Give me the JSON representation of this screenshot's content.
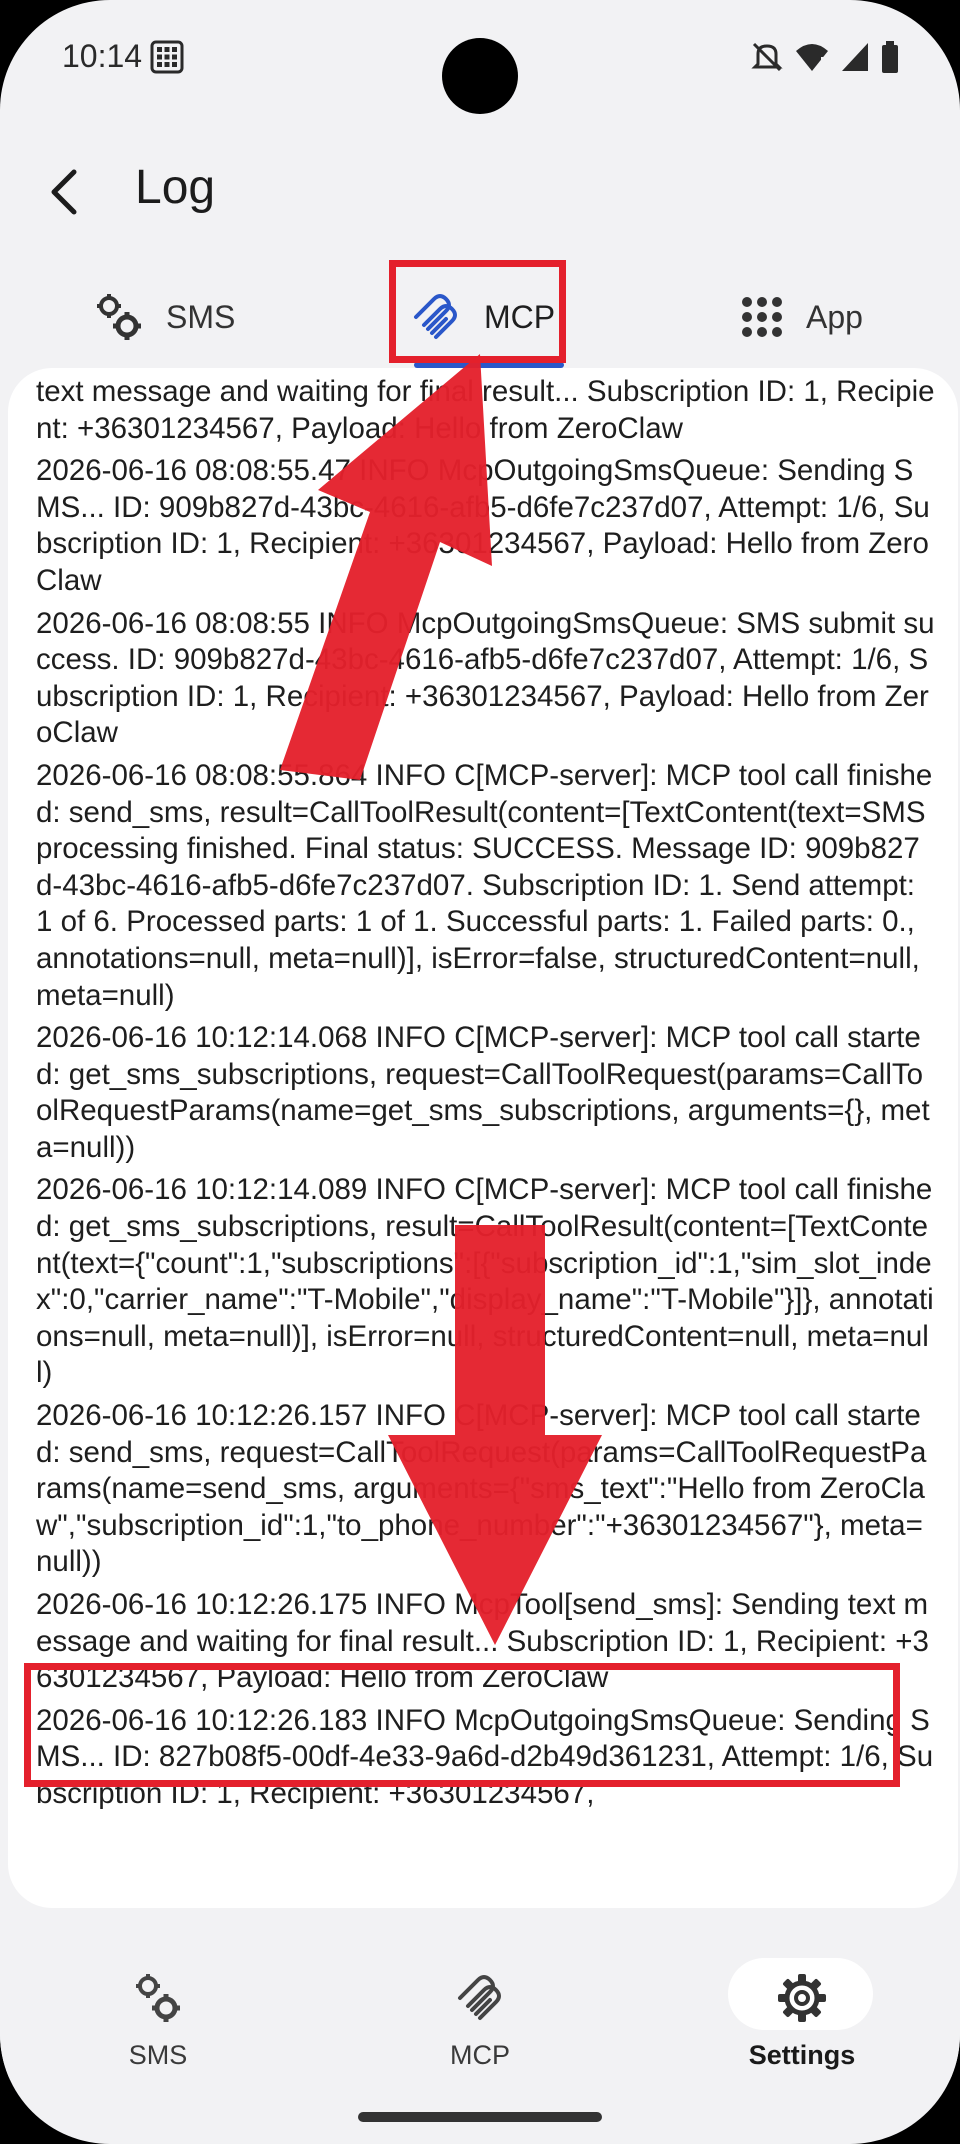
{
  "status_bar": {
    "time": "10:14"
  },
  "header": {
    "title": "Log"
  },
  "tabs": [
    {
      "label": "SMS",
      "icon": "gears-icon"
    },
    {
      "label": "MCP",
      "icon": "mcp-icon"
    },
    {
      "label": "App",
      "icon": "grid-icon"
    }
  ],
  "log": {
    "entries": [
      "text message and waiting for final result... Subscription ID: 1, Recipient: +36301234567, Payload: Hello from ZeroClaw",
      "2026-06-16 08:08:55.47 INFO McpOutgoingSmsQueue: Sending SMS... ID: 909b827d-43bc-4616-afb5-d6fe7c237d07, Attempt: 1/6, Subscription ID: 1, Recipient: +36301234567, Payload: Hello from ZeroClaw",
      "2026-06-16 08:08:55 INFO McpOutgoingSmsQueue: SMS submit success. ID: 909b827d-43bc-4616-afb5-d6fe7c237d07, Attempt: 1/6, Subscription ID: 1, Recipient: +36301234567, Payload: Hello from ZeroClaw",
      "2026-06-16 08:08:55.864 INFO C[MCP-server]: MCP tool call finished: send_sms, result=CallToolResult(content=[TextContent(text=SMS processing finished. Final status: SUCCESS. Message ID: 909b827d-43bc-4616-afb5-d6fe7c237d07. Subscription ID: 1. Send attempt: 1 of 6. Processed parts: 1 of 1. Successful parts: 1. Failed parts: 0., annotations=null, meta=null)], isError=false, structuredContent=null, meta=null)",
      "2026-06-16 10:12:14.068 INFO C[MCP-server]: MCP tool call started: get_sms_subscriptions, request=CallToolRequest(params=CallToolRequestParams(name=get_sms_subscriptions, arguments={}, meta=null))",
      "2026-06-16 10:12:14.089 INFO C[MCP-server]: MCP tool call finished: get_sms_subscriptions, result=CallToolResult(content=[TextContent(text={\"count\":1,\"subscriptions\":[{\"subscription_id\":1,\"sim_slot_index\":0,\"carrier_name\":\"T-Mobile\",\"display_name\":\"T-Mobile\"}]}, annotations=null, meta=null)], isError=null, structuredContent=null, meta=null)",
      "2026-06-16 10:12:26.157 INFO C[MCP-server]: MCP tool call started: send_sms, request=CallToolRequest(params=CallToolRequestParams(name=send_sms, arguments={\"sms_text\":\"Hello from ZeroClaw\",\"subscription_id\":1,\"to_phone_number\":\"+36301234567\"}, meta=null))",
      "2026-06-16 10:12:26.175 INFO McpTool[send_sms]: Sending text message and waiting for final result... Subscription ID: 1, Recipient: +36301234567, Payload: Hello from ZeroClaw",
      "2026-06-16 10:12:26.183 INFO McpOutgoingSmsQueue: Sending SMS... ID: 827b08f5-00df-4e33-9a6d-d2b49d361231, Attempt: 1/6, Subscription ID: 1, Recipient: +36301234567,"
    ]
  },
  "bottom_nav": [
    {
      "label": "SMS",
      "icon": "gears-icon"
    },
    {
      "label": "MCP",
      "icon": "mcp-icon"
    },
    {
      "label": "Settings",
      "icon": "settings-gear-icon",
      "selected": true
    }
  ],
  "colors": {
    "accent": "#2a57c9",
    "highlight": "#e4202c"
  }
}
